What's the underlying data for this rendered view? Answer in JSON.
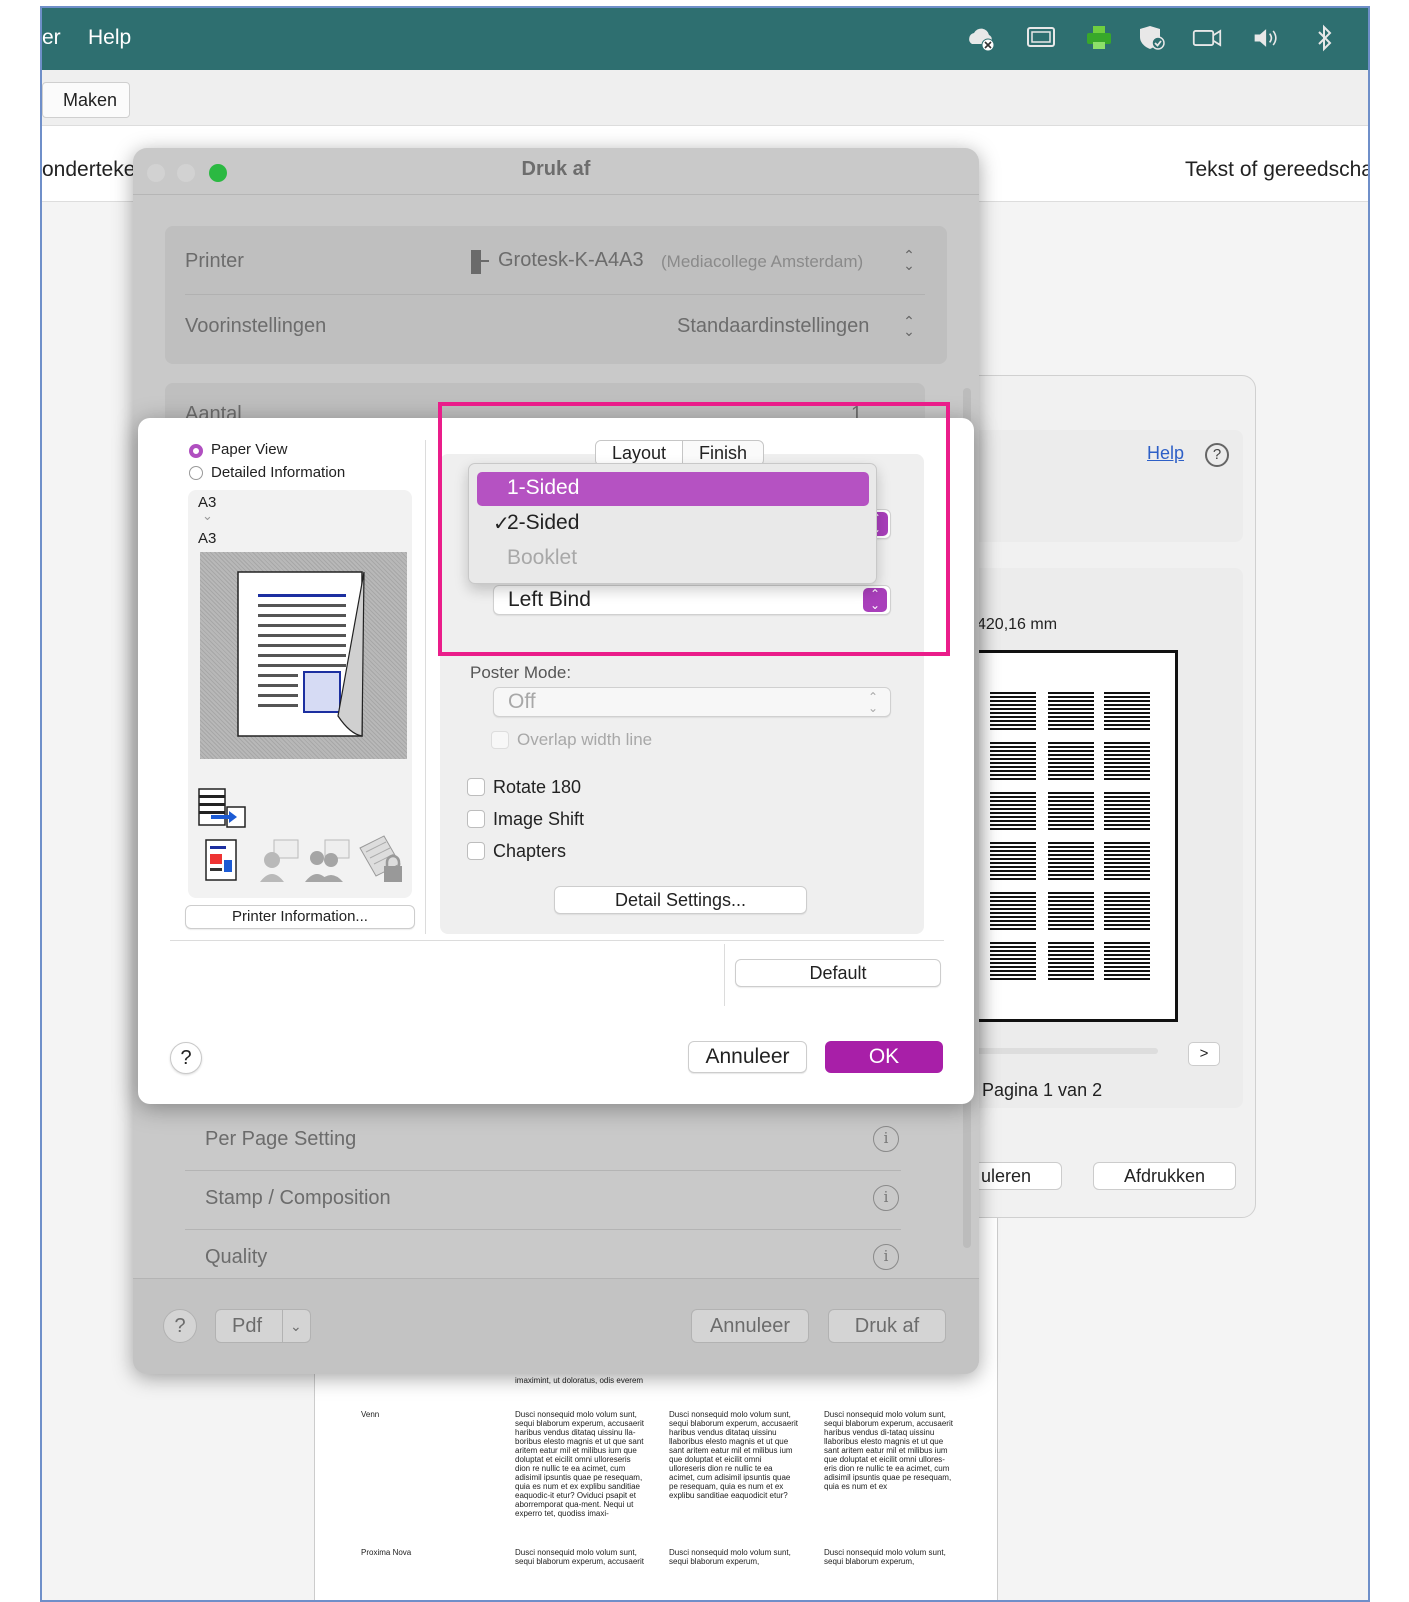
{
  "menubar": {
    "partial_item": "er",
    "help": "Help"
  },
  "toolbar": {
    "maken": "Maken"
  },
  "tabrow": {
    "left_text": "onderteker",
    "right_text": "Tekst of gereedschap"
  },
  "druk_af": {
    "title": "Druk af",
    "printer_label": "Printer",
    "printer_name": "Grotesk-K-A4A3",
    "printer_location": "(Mediacollege Amsterdam)",
    "presets_label": "Voorinstellingen",
    "presets_value": "Standaardinstellingen",
    "aantal_label": "Aantal",
    "aantal_value": "1",
    "list": [
      "Per Page Setting",
      "Stamp / Composition",
      "Quality"
    ],
    "help": "?",
    "pdf": "Pdf",
    "cancel": "Annuleer",
    "print": "Druk af"
  },
  "printer_settings": {
    "view_options": [
      "Paper View",
      "Detailed Information"
    ],
    "paper_from": "A3",
    "paper_to": "A3",
    "printer_info_button": "Printer Information...",
    "tabs": [
      "Layout",
      "Finish"
    ],
    "print_type_menu": {
      "items": [
        "1-Sided",
        "2-Sided",
        "Booklet"
      ],
      "highlighted": "1-Sided",
      "checked": "2-Sided",
      "disabled": "Booklet"
    },
    "binding_value": "Left Bind",
    "poster_mode_label": "Poster Mode:",
    "poster_mode_value": "Off",
    "overlap_label": "Overlap width line",
    "checkboxes": [
      "Rotate 180",
      "Image Shift",
      "Chapters"
    ],
    "detail_settings_button": "Detail Settings...",
    "default_button": "Default",
    "help": "?",
    "cancel": "Annuleer",
    "ok": "OK",
    "accent_color": "#a81fa8"
  },
  "acrobat_panel": {
    "help_link": "Help",
    "help_icon": "?",
    "size_text": "420,16 mm",
    "next": ">",
    "page_text": "Pagina 1 van 2",
    "cancel_partial": "uleren",
    "print_button": "Afdrukken"
  },
  "document": {
    "row_label_1": "Venn",
    "row_label_2": "Proxima Nova",
    "top_line": "imaximint, ut doloratus, odis everem",
    "col_1": "Dusci nonsequid molo volum sunt, sequi blaborum experum, accusaerit haribus vendus ditataq uissinu lla-boribus elesto magnis et ut que sant aritem eatur mil et milibus ium que doluptat et eicilit omni ulloreseris dion re nullic te ea acimet, cum adisimil ipsuntis quae pe resequam, quia es num et ex explibu sanditiae eaquodic-it etur? Oviduci psapit et aborremporat qua-ment. Nequi ut experro tet, quodiss imaxi-",
    "col_2": "Dusci nonsequid molo volum sunt, sequi blaborum experum, accusaerit haribus vendus ditataq uissinu llaboribus elesto magnis et ut que sant aritem eatur mil et milibus ium que doluptat et eicilit omni ulloreseris dion re nullic te ea acimet, cum adisimil ipsuntis quae pe resequam, quia es num et ex explibu sanditiae eaquodicit etur?",
    "col_3": "Dusci nonsequid molo volum sunt, sequi blaborum experum, accusaerit haribus vendus di-tataq uissinu llaboribus elesto magnis et ut que sant aritem eatur mil et milibus ium que doluptat et eicilit omni ullores-eris dion re nullic te ea acimet, cum adisimil ipsuntis quae pe resequam, quia es num et ex",
    "col_1b": "Dusci nonsequid molo volum sunt, sequi blaborum experum, accusaerit",
    "col_2b": "Dusci nonsequid molo volum sunt, sequi blaborum experum,",
    "col_3b": "Dusci nonsequid molo volum sunt, sequi blaborum experum,"
  }
}
